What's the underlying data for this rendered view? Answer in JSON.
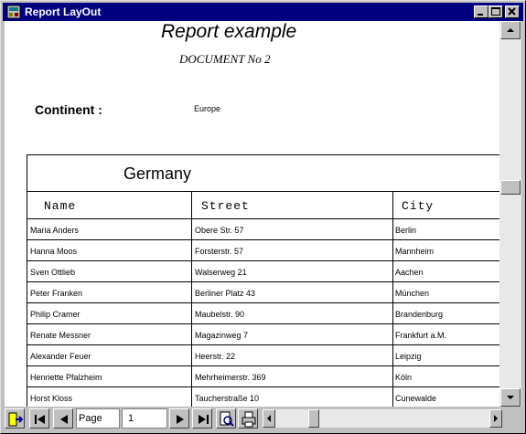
{
  "window": {
    "title": "Report LayOut"
  },
  "report": {
    "title": "Report example",
    "subtitle": "DOCUMENT No 2",
    "continent_label": "Continent :",
    "continent_value": "Europe",
    "country": "Germany",
    "columns": [
      "Name",
      "Street",
      "City"
    ],
    "rows": [
      [
        "Maria Anders",
        "Obere Str. 57",
        "Berlin"
      ],
      [
        "Hanna Moos",
        "Forsterstr. 57",
        "Mannheim"
      ],
      [
        "Sven Ottlieb",
        "Walserweg 21",
        "Aachen"
      ],
      [
        "Peter Franken",
        "Berliner Platz 43",
        "München"
      ],
      [
        "Philip Cramer",
        "Maubelstr. 90",
        "Brandenburg"
      ],
      [
        "Renate Messner",
        "Magazinweg 7",
        "Frankfurt a.M."
      ],
      [
        "Alexander Feuer",
        "Heerstr. 22",
        "Leipzig"
      ],
      [
        "Henriette Pfalzheim",
        "Mehrheimerstr. 369",
        "Köln"
      ],
      [
        "Horst Kloss",
        "Taucherstraße 10",
        "Cunewalde"
      ]
    ]
  },
  "navigation": {
    "page_label": "Page",
    "page_value": "1"
  }
}
